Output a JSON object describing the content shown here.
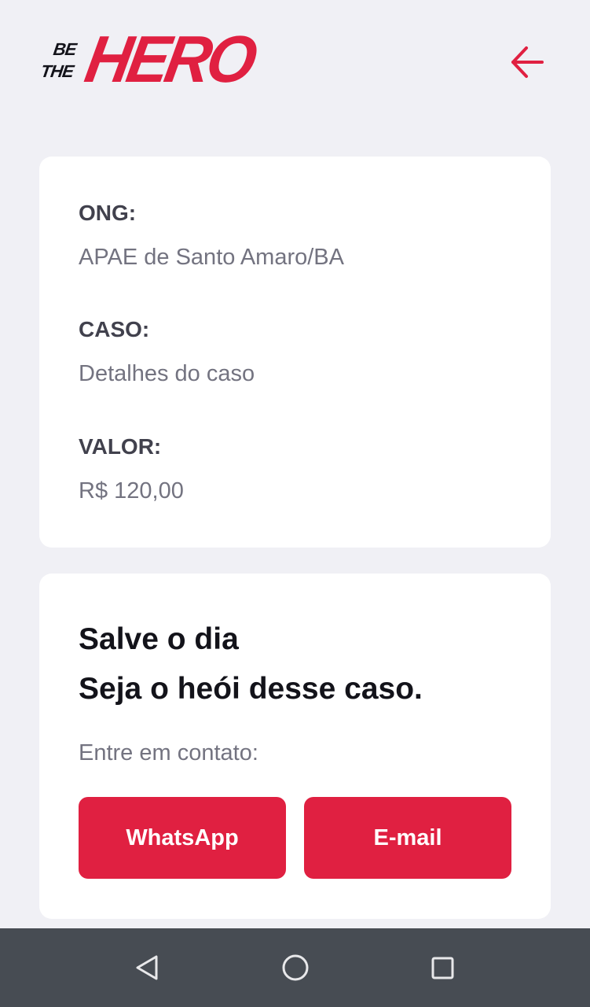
{
  "app": {
    "logo": {
      "small_top": "BE",
      "small_bottom": "THE",
      "big": "HERO"
    },
    "back_icon": "arrow-left-icon",
    "accent_color": "#e02041"
  },
  "incident": {
    "ong_label": "ONG:",
    "ong_value": "APAE de Santo Amaro/BA",
    "case_label": "CASO:",
    "case_value": "Detalhes do caso",
    "value_label": "VALOR:",
    "value_value": "R$ 120,00"
  },
  "contact": {
    "title_line1": "Salve o dia",
    "title_line2": "Seja o heói desse caso.",
    "prompt": "Entre em contato:",
    "whatsapp_label": "WhatsApp",
    "email_label": "E-mail"
  },
  "nav_bar": {
    "back_icon": "triangle-back-icon",
    "home_icon": "circle-home-icon",
    "recents_icon": "square-recents-icon"
  }
}
